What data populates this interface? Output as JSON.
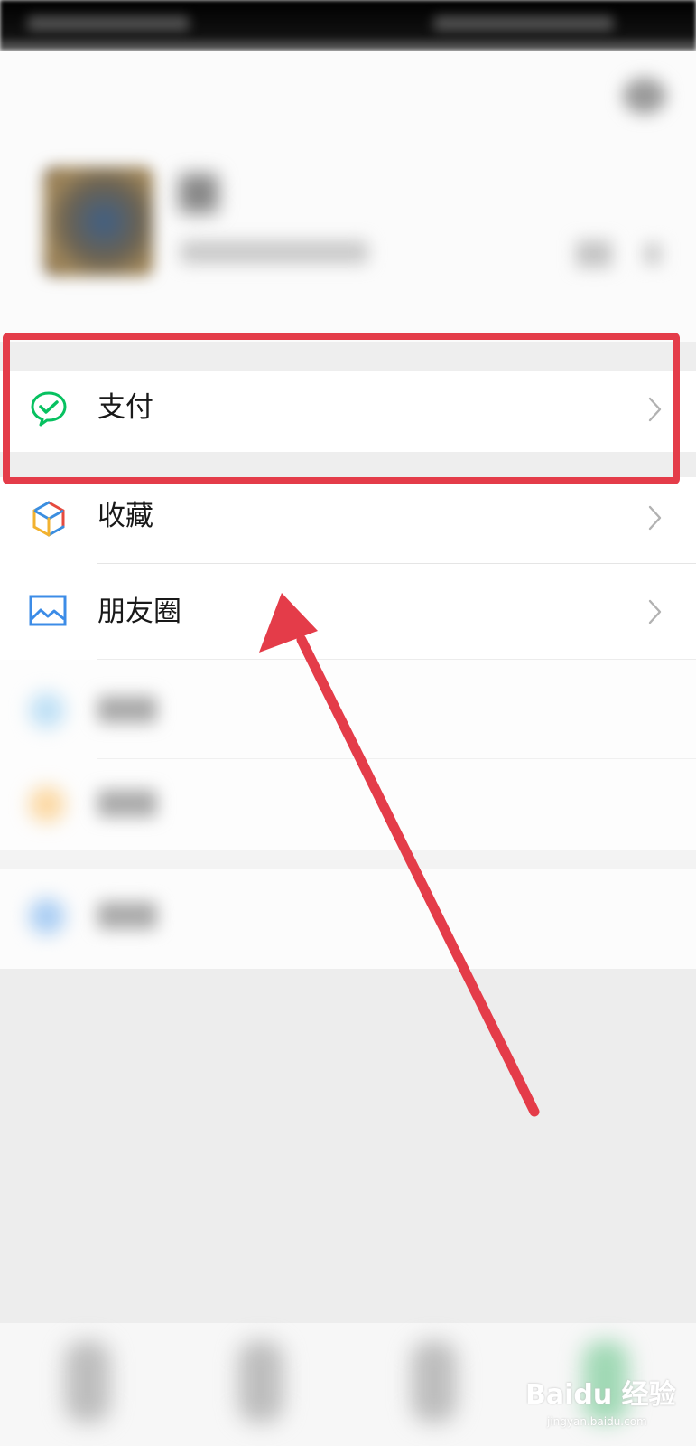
{
  "menu": {
    "pay": {
      "label": "支付",
      "icon": "wechat-pay-icon"
    },
    "favorites": {
      "label": "收藏",
      "icon": "favorites-cube-icon"
    },
    "moments": {
      "label": "朋友圈",
      "icon": "moments-picture-icon"
    }
  },
  "watermark": {
    "brand": "Baidu 经验",
    "url": "jingyan.baidu.com"
  },
  "colors": {
    "highlight": "#e43c49",
    "pay_green": "#07c160",
    "background": "#ededed"
  }
}
